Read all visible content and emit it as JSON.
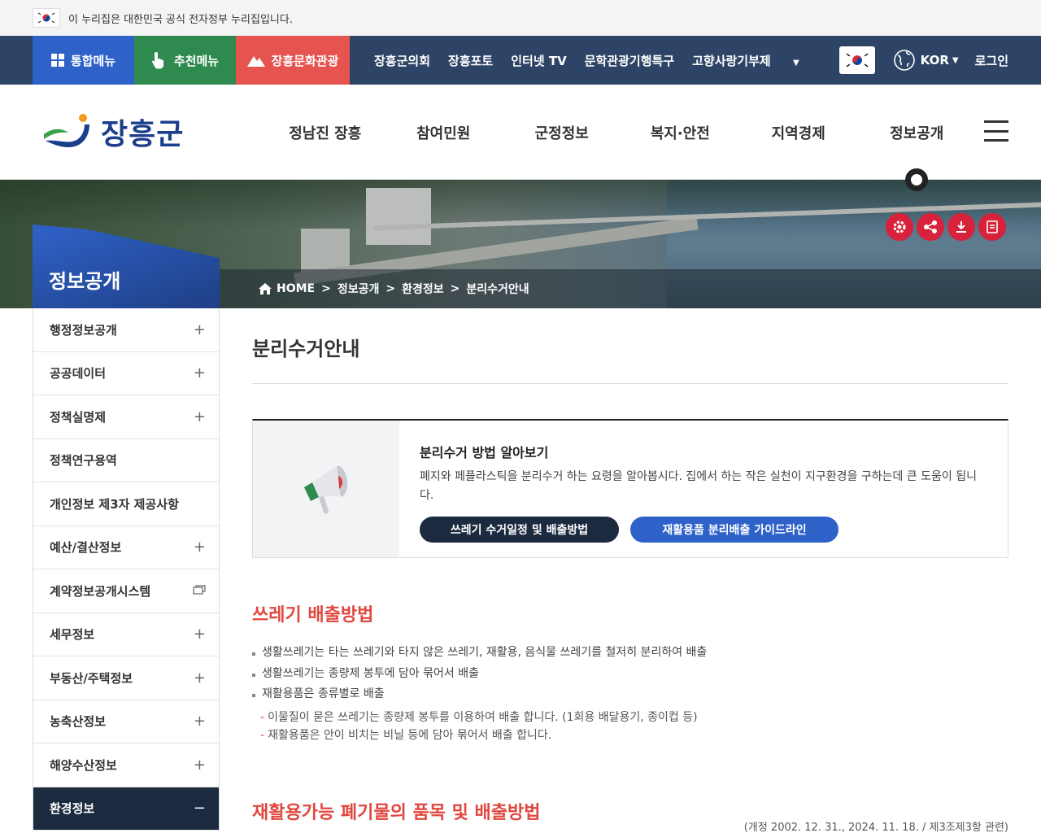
{
  "gov_banner": {
    "text": "이 누리집은 대한민국 공식 전자정부 누리집입니다."
  },
  "utility": {
    "total_menu": "통합메뉴",
    "recommend_menu": "추천메뉴",
    "culture_tour": "장흥문화관광",
    "links": [
      "장흥군의회",
      "장흥포토",
      "인터넷 TV",
      "문학관광기행특구",
      "고향사랑기부제"
    ],
    "language": "KOR",
    "login": "로그인"
  },
  "header": {
    "logo_text": "장흥군",
    "gnb": [
      "정남진 장흥",
      "참여민원",
      "군정정보",
      "복지·안전",
      "지역경제",
      "정보공개"
    ]
  },
  "breadcrumb": {
    "home": "HOME",
    "level1": "정보공개",
    "level2": "환경정보",
    "level3": "분리수거안내"
  },
  "lnb": {
    "title": "정보공개",
    "items": [
      {
        "label": "행정정보공개",
        "mark": "+"
      },
      {
        "label": "공공데이터",
        "mark": "+"
      },
      {
        "label": "정책실명제",
        "mark": "+"
      },
      {
        "label": "정책연구용역",
        "mark": ""
      },
      {
        "label": "개인정보 제3자 제공사항",
        "mark": ""
      },
      {
        "label": "예산/결산정보",
        "mark": "+"
      },
      {
        "label": "계약정보공개시스템",
        "mark": "window"
      },
      {
        "label": "세무정보",
        "mark": "+"
      },
      {
        "label": "부동산/주택정보",
        "mark": "+"
      },
      {
        "label": "농축산정보",
        "mark": "+"
      },
      {
        "label": "해양수산정보",
        "mark": "+"
      },
      {
        "label": "환경정보",
        "mark": "−"
      }
    ]
  },
  "content": {
    "page_title": "분리수거안내",
    "guide": {
      "title": "분리수거 방법 알아보기",
      "desc": "폐지와 페플라스틱을 분리수거 하는 요령을 알아봅시다. 집에서 하는 작은 실천이 지구환경을 구하는데 큰 도움이 됩니다.",
      "btn_schedule": "쓰레기 수거일정 및 배출방법",
      "btn_guideline": "재활용품 분리배출 가이드라인"
    },
    "section1": {
      "title": "쓰레기 배출방법",
      "bullets": [
        "생활쓰레기는 타는 쓰레기와 타지 않은 쓰레기, 재활용, 음식물 쓰레기를 철저히 분리하여 배출",
        "생활쓰레기는 종량제 봉투에 담아 묶어서 배출",
        "재활용품은 종류별로 배출"
      ],
      "subs": [
        "이물질이 묻은 쓰레기는 종량제 봉투를 이용하여 배출 합니다. (1회용 배달용기, 종이컵 등)",
        "재활용품은 안이 비치는 비닐 등에 담아 묶어서 배출 합니다."
      ]
    },
    "section2": {
      "title": "재활용가능 폐기물의 품목 및 배출방법",
      "note": "(개정 2002. 12. 31., 2024. 11. 18. / 제3조제3항 관련)"
    }
  },
  "colors": {
    "nav_bg": "#2e4466",
    "accent_red": "#e0473f",
    "primary_blue": "#2f62c9",
    "dark_navy": "#1c2a40"
  }
}
